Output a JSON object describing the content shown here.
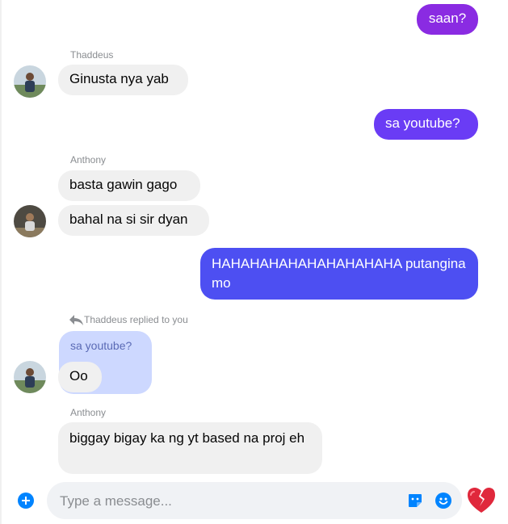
{
  "messages": {
    "m1": {
      "text": "saan?"
    },
    "m2": {
      "sender": "Thaddeus",
      "text": "Ginusta nya yab"
    },
    "m3": {
      "text": "sa youtube?"
    },
    "m4": {
      "sender": "Anthony",
      "text": "basta gawin gago"
    },
    "m5": {
      "text": "bahal na si sir dyan"
    },
    "m6": {
      "text": "HAHAHAHAHAHAHAHAHAHA putangina mo"
    },
    "m7": {
      "reply_label": "Thaddeus replied to you",
      "quoted": "sa youtube?",
      "text": "Oo"
    },
    "m8": {
      "sender": "Anthony",
      "text": "biggay bigay ka ng yt based na proj eh"
    }
  },
  "composer": {
    "placeholder": "Type a message..."
  },
  "colors": {
    "out_purple": "#8a2be2",
    "out_violet": "#6a3cf5",
    "out_blue": "#4d4ff2",
    "incoming": "#f0f0f0",
    "accent": "#0084ff"
  },
  "icons": {
    "add": "plus-circle-icon",
    "sticker": "sticker-icon",
    "emoji": "emoji-icon",
    "reaction": "broken-heart-icon",
    "reply": "reply-arrow-icon"
  }
}
